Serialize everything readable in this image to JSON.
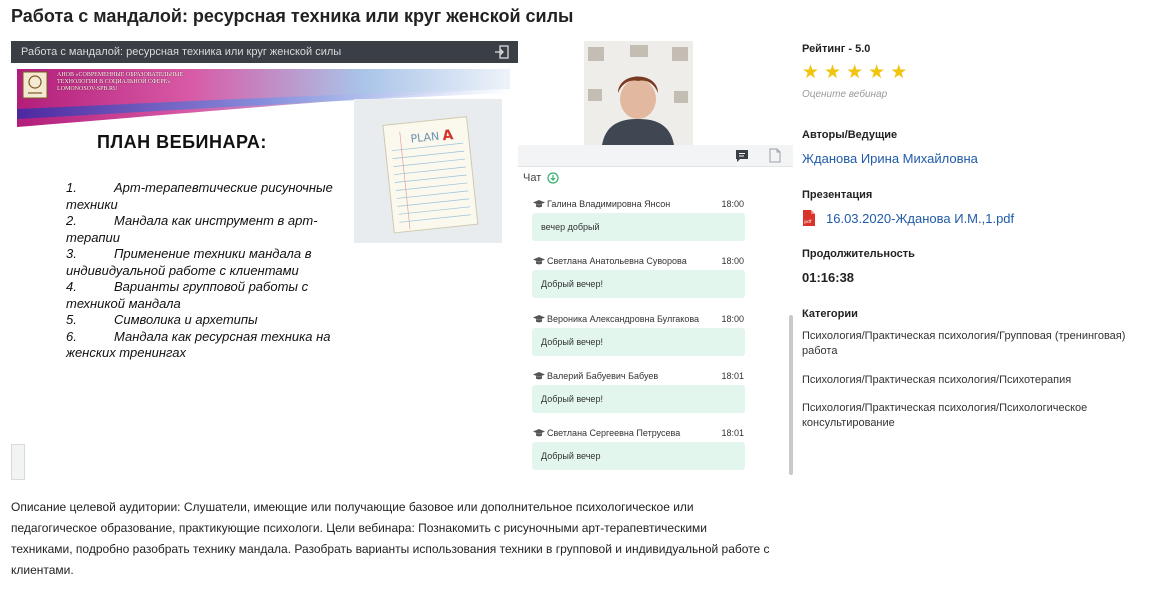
{
  "page": {
    "title": "Работа с мандалой: ресурсная техника или круг женской силы"
  },
  "player": {
    "bar_title": "Работа с мандалой: ресурсная техника или круг женской силы",
    "slide": {
      "banner_text": "АНОВ «СОВРЕМЕННЫЕ ОБРАЗОВАТЕЛЬНЫЕ ТЕХНОЛОГИИ В СОЦИАЛЬНОЙ СФЕРЕ» LOMONOSOV-SPB.RU",
      "plan_title": "ПЛАН ВЕБИНАРА:",
      "items": [
        {
          "num": "1.",
          "text": "Арт-терапевтические рисуночные техники"
        },
        {
          "num": "2.",
          "text": "Мандала как инструмент в арт-терапии"
        },
        {
          "num": "3.",
          "text": "Применение техники мандала в индивидуальной работе с клиентами"
        },
        {
          "num": "4.",
          "text": "Варианты групповой работы с техникой мандала"
        },
        {
          "num": "5.",
          "text": "Символика и архетипы"
        },
        {
          "num": "6.",
          "text": "Мандала как ресурсная техника на женских тренингах"
        }
      ],
      "note_text": "PLAN A"
    }
  },
  "chat": {
    "header": "Чат",
    "messages": [
      {
        "name": "Галина Владимировна Янсон",
        "time": "18:00",
        "text": "вечер добрый"
      },
      {
        "name": "Светлана Анатольевна Суворова",
        "time": "18:00",
        "text": "Добрый вечер!"
      },
      {
        "name": "Вероника Александровна Булгакова",
        "time": "18:00",
        "text": "Добрый вечер!"
      },
      {
        "name": "Валерий Бабуевич Бабуев",
        "time": "18:01",
        "text": "Добрый вечер!"
      },
      {
        "name": "Светлана Сергеевна Петрусева",
        "time": "18:01",
        "text": "Добрый вечер"
      }
    ]
  },
  "sidebar": {
    "rating_label": "Рейтинг - 5.0",
    "rating_value": 5,
    "rating_max": 5,
    "rate_hint": "Оцените вебинар",
    "authors_label": "Авторы/Ведущие",
    "author": "Жданова Ирина Михайловна",
    "presentation_label": "Презентация",
    "presentation_file": "16.03.2020-Жданова И.М.,1.pdf",
    "duration_label": "Продолжительность",
    "duration": "01:16:38",
    "categories_label": "Категории",
    "categories": [
      "Психология/Практическая психология/Групповая (тренинговая) работа",
      "Психология/Практическая психология/Психотерапия",
      "Психология/Практическая психология/Психологическое консультирование"
    ]
  },
  "description": "Описание целевой аудитории: Слушатели, имеющие или получающие базовое или дополнительное психологическое или педагогическое образование, практикующие психологи. Цели вебинара: Познакомить с рисуночными арт-терапевтическими техниками, подробно разобрать технику мандала. Разобрать варианты использования техники в групповой и индивидуальной работе с клиентами.",
  "colors": {
    "star": "#f1c40f",
    "link": "#1f5aa8",
    "chat_bubble": "#e2f6ee",
    "player_bar": "#3a3e45",
    "pdf": "#d9342b"
  }
}
